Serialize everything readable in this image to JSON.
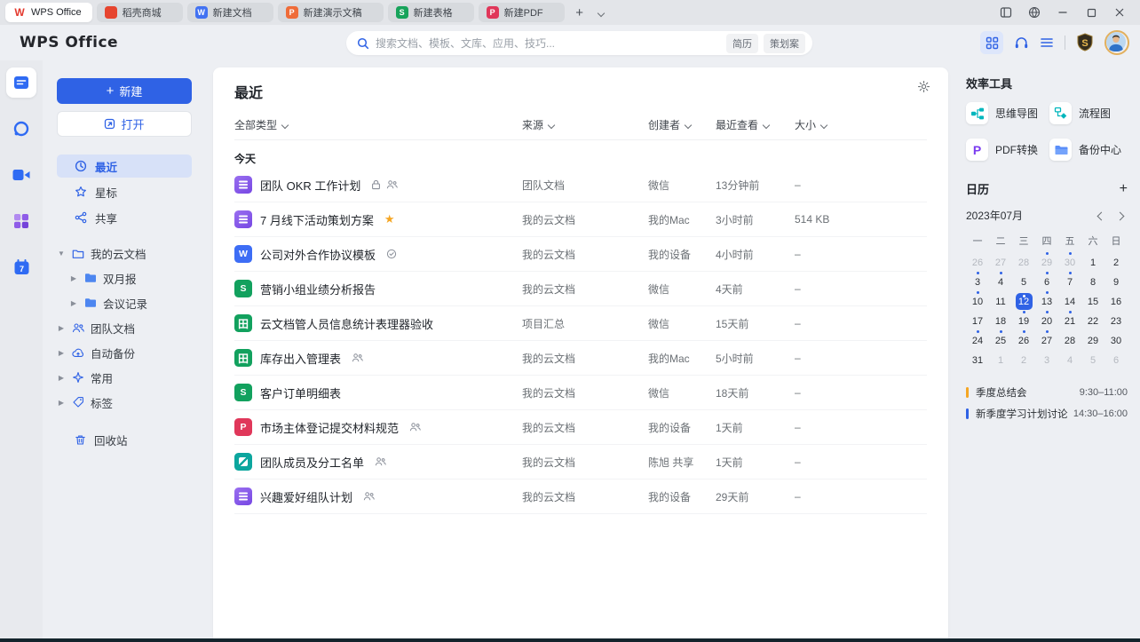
{
  "colors": {
    "accent": "#2f62e5",
    "star": "#f5a623",
    "event_quarter": "#f5a623",
    "event_study": "#2f62e5"
  },
  "window": {
    "tabs": [
      {
        "label": "WPS Office",
        "icon": "wps-logo",
        "active": true
      },
      {
        "label": "稻壳商城",
        "icon": "docer",
        "active": false
      },
      {
        "label": "新建文档",
        "icon": "writer",
        "active": false
      },
      {
        "label": "新建演示文稿",
        "icon": "presentation",
        "active": false
      },
      {
        "label": "新建表格",
        "icon": "spreadsheet",
        "active": false
      },
      {
        "label": "新建PDF",
        "icon": "pdf",
        "active": false
      }
    ]
  },
  "header": {
    "logo": "WPS Office",
    "search": {
      "placeholder": "搜索文档、模板、文库、应用、技巧...",
      "tags": [
        "简历",
        "策划案"
      ]
    }
  },
  "sidebar": {
    "new_button": "新建",
    "open_button": "打开",
    "nav": [
      {
        "label": "最近",
        "icon": "clock",
        "active": true
      },
      {
        "label": "星标",
        "icon": "star",
        "active": false
      },
      {
        "label": "共享",
        "icon": "share",
        "active": false
      }
    ],
    "tree": [
      {
        "label": "我的云文档",
        "icon": "cloud-folder",
        "arrow": "down",
        "level": 0
      },
      {
        "label": "双月报",
        "icon": "folder",
        "arrow": "right",
        "level": 1
      },
      {
        "label": "会议记录",
        "icon": "folder",
        "arrow": "right",
        "level": 1
      },
      {
        "label": "团队文档",
        "icon": "team",
        "arrow": "right",
        "level": 0
      },
      {
        "label": "自动备份",
        "icon": "backup",
        "arrow": "right",
        "level": 0
      },
      {
        "label": "常用",
        "icon": "frequent",
        "arrow": "right",
        "level": 0
      },
      {
        "label": "标签",
        "icon": "tag",
        "arrow": "right",
        "level": 0
      }
    ],
    "trash": "回收站"
  },
  "main": {
    "title": "最近",
    "filters": [
      "全部类型",
      "来源",
      "创建者",
      "最近查看",
      "大小"
    ],
    "group": "今天",
    "files": [
      {
        "type": "doc",
        "name": "团队 OKR 工作计划",
        "badges": [
          "lock",
          "people"
        ],
        "source": "团队文档",
        "creator": "微信",
        "viewed": "13分钟前",
        "size": "–"
      },
      {
        "type": "doc",
        "name": "7 月线下活动策划方案",
        "badges": [
          "star"
        ],
        "source": "我的云文档",
        "creator": "我的Mac",
        "viewed": "3小时前",
        "size": "514 KB"
      },
      {
        "type": "word",
        "name": "公司对外合作协议模板",
        "badges": [
          "badge"
        ],
        "source": "我的云文档",
        "creator": "我的设备",
        "viewed": "4小时前",
        "size": "–"
      },
      {
        "type": "sheet",
        "name": "营销小组业绩分析报告",
        "badges": [],
        "source": "我的云文档",
        "creator": "微信",
        "viewed": "4天前",
        "size": "–"
      },
      {
        "type": "ssheet",
        "name": "云文档管人员信息统计表理器验收",
        "badges": [],
        "source": "项目汇总",
        "creator": "微信",
        "viewed": "15天前",
        "size": "–"
      },
      {
        "type": "ssheet",
        "name": "库存出入管理表",
        "badges": [
          "people"
        ],
        "source": "我的云文档",
        "creator": "我的Mac",
        "viewed": "5小时前",
        "size": "–"
      },
      {
        "type": "sheet",
        "name": "客户订单明细表",
        "badges": [],
        "source": "我的云文档",
        "creator": "微信",
        "viewed": "18天前",
        "size": "–"
      },
      {
        "type": "pdf",
        "name": "市场主体登记提交材料规范",
        "badges": [
          "people"
        ],
        "source": "我的云文档",
        "creator": "我的设备",
        "viewed": "1天前",
        "size": "–"
      },
      {
        "type": "form",
        "name": "团队成员及分工名单",
        "badges": [
          "people"
        ],
        "source": "我的云文档",
        "creator": "陈旭 共享",
        "viewed": "1天前",
        "size": "–"
      },
      {
        "type": "doc",
        "name": "兴趣爱好组队计划",
        "badges": [
          "people"
        ],
        "source": "我的云文档",
        "creator": "我的设备",
        "viewed": "29天前",
        "size": "–"
      }
    ]
  },
  "tools": {
    "title": "效率工具",
    "items": [
      {
        "label": "思维导图",
        "icon": "mindmap"
      },
      {
        "label": "流程图",
        "icon": "flowchart"
      },
      {
        "label": "PDF转换",
        "icon": "pdf-convert"
      },
      {
        "label": "备份中心",
        "icon": "backup-center"
      }
    ]
  },
  "calendar": {
    "title": "日历",
    "month": "2023年07月",
    "weekdays": [
      "一",
      "二",
      "三",
      "四",
      "五",
      "六",
      "日"
    ],
    "days": [
      {
        "d": "26",
        "muted": true
      },
      {
        "d": "27",
        "muted": true
      },
      {
        "d": "28",
        "muted": true
      },
      {
        "d": "29",
        "muted": true,
        "dot": true
      },
      {
        "d": "30",
        "muted": true,
        "dot": true
      },
      {
        "d": "1"
      },
      {
        "d": "2"
      },
      {
        "d": "3",
        "dot": true
      },
      {
        "d": "4",
        "dot": true
      },
      {
        "d": "5"
      },
      {
        "d": "6",
        "dot": true
      },
      {
        "d": "7",
        "dot": true
      },
      {
        "d": "8"
      },
      {
        "d": "9"
      },
      {
        "d": "10",
        "dot": true
      },
      {
        "d": "11"
      },
      {
        "d": "12",
        "dot": true,
        "selected": true
      },
      {
        "d": "13",
        "dot": true
      },
      {
        "d": "14"
      },
      {
        "d": "15"
      },
      {
        "d": "16"
      },
      {
        "d": "17"
      },
      {
        "d": "18"
      },
      {
        "d": "19",
        "dot": true
      },
      {
        "d": "20",
        "dot": true
      },
      {
        "d": "21",
        "dot": true
      },
      {
        "d": "22"
      },
      {
        "d": "23"
      },
      {
        "d": "24",
        "dot": true
      },
      {
        "d": "25",
        "dot": true
      },
      {
        "d": "26",
        "dot": true
      },
      {
        "d": "27",
        "dot": true
      },
      {
        "d": "28"
      },
      {
        "d": "29"
      },
      {
        "d": "30"
      },
      {
        "d": "31"
      },
      {
        "d": "1",
        "muted": true
      },
      {
        "d": "2",
        "muted": true
      },
      {
        "d": "3",
        "muted": true
      },
      {
        "d": "4",
        "muted": true
      },
      {
        "d": "5",
        "muted": true
      },
      {
        "d": "6",
        "muted": true
      }
    ],
    "events": [
      {
        "title": "季度总结会",
        "time": "9:30–11:00",
        "color": "#f5a623"
      },
      {
        "title": "新季度学习计划讨论",
        "time": "14:30–16:00",
        "color": "#2f62e5"
      }
    ]
  }
}
